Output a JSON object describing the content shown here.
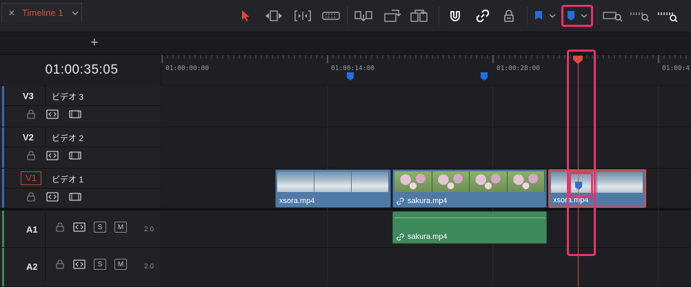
{
  "toolbar": {
    "icons": [
      "layout-icon",
      "selection-arrow-icon",
      "trim-icon",
      "dynamic-trim-icon",
      "blade-icon",
      "insert-clip-icon",
      "overwrite-clip-icon",
      "replace-clip-icon",
      "snapping-icon",
      "linked-selection-icon",
      "position-lock-icon",
      "flag-icon",
      "marker-icon",
      "zoom-full-icon",
      "zoom-detail-icon",
      "zoom-custom-icon"
    ],
    "accent": "#e8336b",
    "flag_color": "#1f6fe0",
    "marker_color": "#1f6fe0"
  },
  "tab": {
    "name": "Timeline 1",
    "close": "✕",
    "add": "+"
  },
  "timecode": "01:00:35:05",
  "ruler": {
    "labels": [
      "01:00:00:00",
      "01:00:14:00",
      "01:00:28:00",
      "01:00:4"
    ]
  },
  "tracks": [
    {
      "id": "V3",
      "name": "ビデオ 3"
    },
    {
      "id": "V2",
      "name": "ビデオ 2"
    },
    {
      "id": "V1",
      "name": "ビデオ 1"
    }
  ],
  "audio_tracks": [
    {
      "id": "A1",
      "solo": "S",
      "mute": "M",
      "channels": "2.0"
    },
    {
      "id": "A2",
      "solo": "S",
      "mute": "M",
      "channels": "2.0"
    }
  ],
  "clips": {
    "v1_a": {
      "name": "xsora.mp4"
    },
    "v1_b": {
      "name": "sakura.mp4"
    },
    "v1_c": {
      "name": "xsora.mp4"
    },
    "a1_b": {
      "name": "sakura.mp4"
    }
  },
  "colors": {
    "video_clip": "#4f7aa6",
    "audio_clip": "#3f8a5c",
    "playhead": "#e04b3c",
    "video_stripe": "#2f6db3",
    "audio_stripe": "#3f8a57"
  }
}
